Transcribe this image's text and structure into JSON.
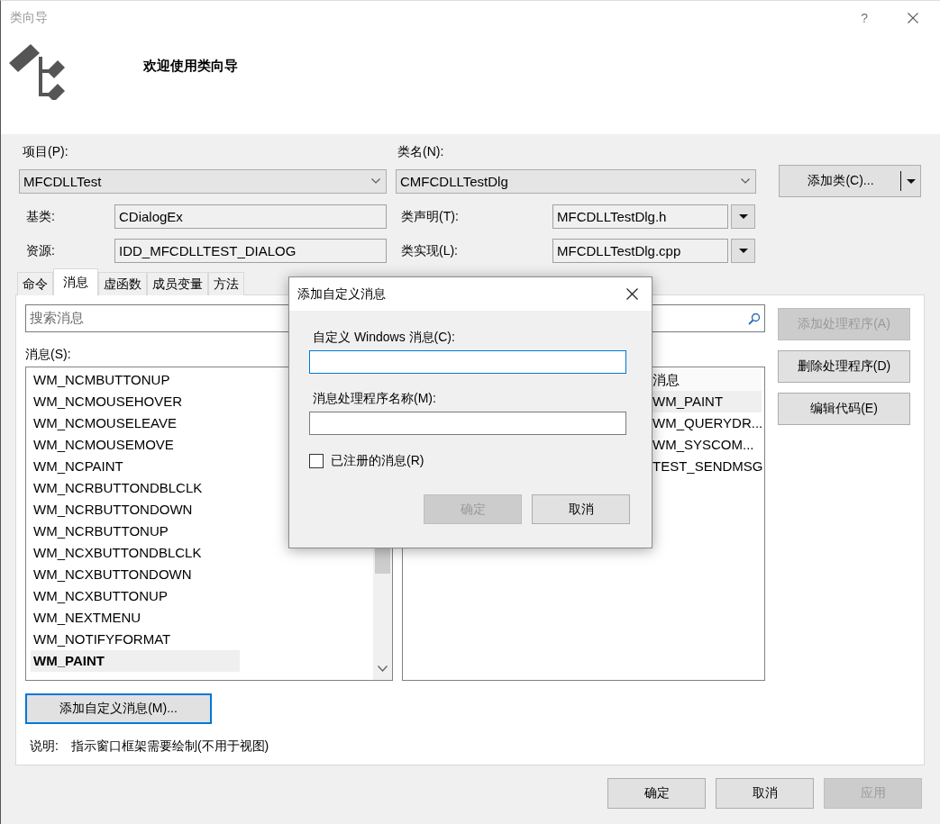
{
  "window": {
    "title": "类向导",
    "help": "?"
  },
  "header": {
    "heading": "欢迎使用类向导"
  },
  "project": {
    "label": "项目(P):",
    "value": "MFCDLLTest"
  },
  "class_name": {
    "label": "类名(N):",
    "value": "CMFCDLLTestDlg"
  },
  "add_class_button": {
    "label": "添加类(C)..."
  },
  "base_class": {
    "label": "基类:",
    "value": "CDialogEx"
  },
  "resource": {
    "label": "资源:",
    "value": "IDD_MFCDLLTEST_DIALOG"
  },
  "class_declaration": {
    "label": "类声明(T):",
    "value": "MFCDLLTestDlg.h"
  },
  "class_implementation": {
    "label": "类实现(L):",
    "value": "MFCDLLTestDlg.cpp"
  },
  "tabs": [
    {
      "label": "命令",
      "selected": false
    },
    {
      "label": "消息",
      "selected": true
    },
    {
      "label": "虚函数",
      "selected": false
    },
    {
      "label": "成员变量",
      "selected": false
    },
    {
      "label": "方法",
      "selected": false
    }
  ],
  "messages_panel": {
    "search": {
      "placeholder": "搜索消息"
    },
    "list_label": "消息(S):",
    "messages": [
      {
        "name": "WM_NCMBUTTONUP",
        "selected": false
      },
      {
        "name": "WM_NCMOUSEHOVER",
        "selected": false
      },
      {
        "name": "WM_NCMOUSELEAVE",
        "selected": false
      },
      {
        "name": "WM_NCMOUSEMOVE",
        "selected": false
      },
      {
        "name": "WM_NCPAINT",
        "selected": false
      },
      {
        "name": "WM_NCRBUTTONDBLCLK",
        "selected": false
      },
      {
        "name": "WM_NCRBUTTONDOWN",
        "selected": false
      },
      {
        "name": "WM_NCRBUTTONUP",
        "selected": false
      },
      {
        "name": "WM_NCXBUTTONDBLCLK",
        "selected": false
      },
      {
        "name": "WM_NCXBUTTONDOWN",
        "selected": false
      },
      {
        "name": "WM_NCXBUTTONUP",
        "selected": false
      },
      {
        "name": "WM_NEXTMENU",
        "selected": false
      },
      {
        "name": "WM_NOTIFYFORMAT",
        "selected": false
      },
      {
        "name": "WM_PAINT",
        "selected": true
      }
    ],
    "handlers_header": "消息",
    "handlers": [
      {
        "name": "WM_PAINT",
        "selected": true
      },
      {
        "name": "WM_QUERYDR...",
        "selected": false
      },
      {
        "name": "WM_SYSCOM...",
        "selected": false
      },
      {
        "name": "TEST_SENDMSG",
        "selected": false
      }
    ],
    "buttons": [
      {
        "label": "添加处理程序(A)",
        "disabled": true
      },
      {
        "label": "删除处理程序(D)",
        "disabled": false
      },
      {
        "label": "编辑代码(E)",
        "disabled": false
      }
    ],
    "add_custom_button": {
      "label": "添加自定义消息(M)...",
      "focused": true
    },
    "description_label": "说明:",
    "description": "指示窗口框架需要绘制(不用于视图)"
  },
  "footer_buttons": [
    {
      "label": "确定",
      "disabled": false
    },
    {
      "label": "取消",
      "disabled": false
    },
    {
      "label": "应用",
      "disabled": true
    }
  ],
  "modal": {
    "title": "添加自定义消息",
    "fields": [
      {
        "label": "自定义 Windows 消息(C):",
        "focused": true
      },
      {
        "label": "消息处理程序名称(M):",
        "focused": false
      }
    ],
    "registered": {
      "label": "已注册的消息(R)",
      "checked": false
    },
    "buttons": [
      {
        "label": "确定",
        "disabled": true
      },
      {
        "label": "取消",
        "disabled": false
      }
    ]
  }
}
